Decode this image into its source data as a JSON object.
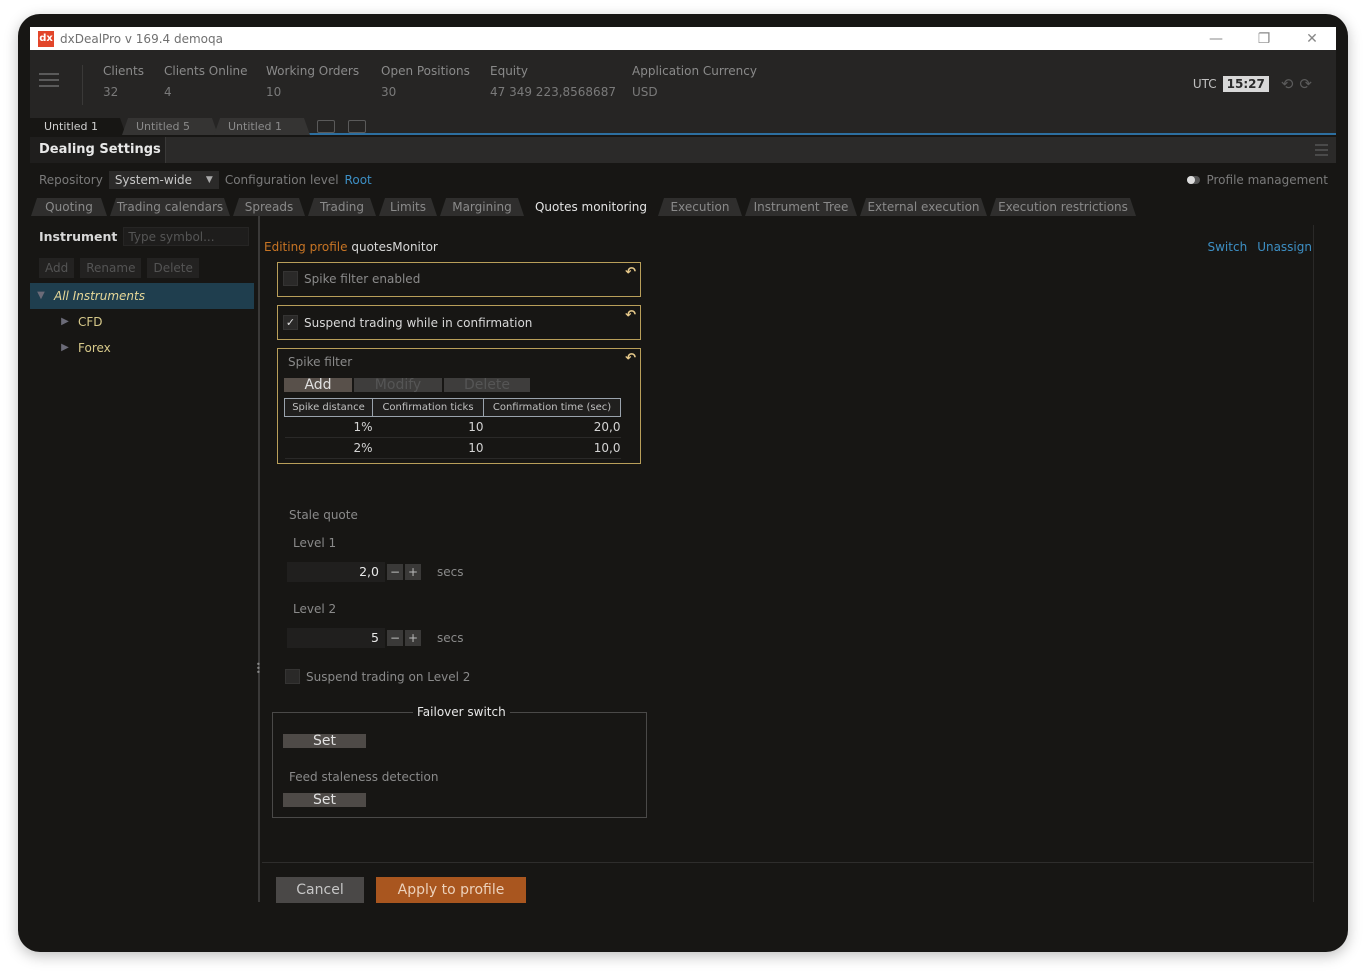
{
  "window": {
    "logo": "dx",
    "title": "dxDealPro v 169.4 demoqa",
    "minimize_icon": "—",
    "restore_icon": "❐",
    "close_icon": "✕"
  },
  "stats": [
    {
      "label": "Clients",
      "value": "32"
    },
    {
      "label": "Clients Online",
      "value": "4"
    },
    {
      "label": "Working Orders",
      "value": "10"
    },
    {
      "label": "Open Positions",
      "value": "30"
    },
    {
      "label": "Equity",
      "value": "47 349 223,8568687"
    },
    {
      "label": "Application Currency",
      "value": "USD"
    }
  ],
  "clock": {
    "timezone": "UTC",
    "time": "15:27",
    "undo_icon": "⟲",
    "redo_icon": "⟳"
  },
  "workspace_tabs": [
    {
      "label": "Untitled 1",
      "active": true
    },
    {
      "label": "Untitled 5",
      "active": false
    },
    {
      "label": "Untitled 1",
      "active": false
    }
  ],
  "panel": {
    "title": "Dealing Settings"
  },
  "repository": {
    "label": "Repository",
    "value": "System-wide",
    "config_label": "Configuration level",
    "config_value": "Root",
    "profile_management": "Profile management"
  },
  "settings_tabs": [
    {
      "label": "Quoting"
    },
    {
      "label": "Trading calendars"
    },
    {
      "label": "Spreads"
    },
    {
      "label": "Trading"
    },
    {
      "label": "Limits"
    },
    {
      "label": "Margining"
    },
    {
      "label": "Quotes monitoring",
      "active": true
    },
    {
      "label": "Execution"
    },
    {
      "label": "Instrument Tree"
    },
    {
      "label": "External execution"
    },
    {
      "label": "Execution restrictions"
    }
  ],
  "instruments": {
    "label": "Instrument",
    "placeholder": "Type symbol...",
    "buttons": [
      "Add",
      "Rename",
      "Delete"
    ],
    "tree": [
      {
        "label": "All Instruments",
        "expanded": true,
        "selected": true
      },
      {
        "label": "CFD",
        "expanded": false
      },
      {
        "label": "Forex",
        "expanded": false
      }
    ]
  },
  "editor": {
    "editing_label": "Editing profile",
    "profile_name": "quotesMonitor",
    "switch_label": "Switch",
    "unassign_label": "Unassign",
    "spike_filter_enabled": {
      "label": "Spike filter enabled",
      "checked": false
    },
    "suspend_in_confirmation": {
      "label": "Suspend trading while in confirmation",
      "checked": true
    },
    "spike_filter": {
      "title": "Spike filter",
      "buttons": [
        "Add",
        "Modify",
        "Delete"
      ],
      "columns": [
        "Spike distance",
        "Confirmation ticks",
        "Confirmation time (sec)"
      ],
      "rows": [
        [
          "1%",
          "10",
          "20,0"
        ],
        [
          "2%",
          "10",
          "10,0"
        ]
      ]
    },
    "stale_quote": {
      "title": "Stale quote",
      "level1_label": "Level 1",
      "level1_value": "2,0",
      "level2_label": "Level 2",
      "level2_value": "5",
      "unit": "secs",
      "minus": "−",
      "plus": "+"
    },
    "suspend_on_level2": {
      "label": "Suspend trading on Level 2",
      "checked": false
    },
    "failover": {
      "title": "Failover switch",
      "set_label": "Set",
      "feed_staleness_label": "Feed staleness detection",
      "set2_label": "Set"
    },
    "cancel_label": "Cancel",
    "apply_label": "Apply to profile"
  },
  "colors": {
    "accent_orange": "#a9561f",
    "link_blue": "#3d8fc4",
    "highlight_border": "#b99f5a",
    "tree_selected": "#1f3e4e"
  }
}
